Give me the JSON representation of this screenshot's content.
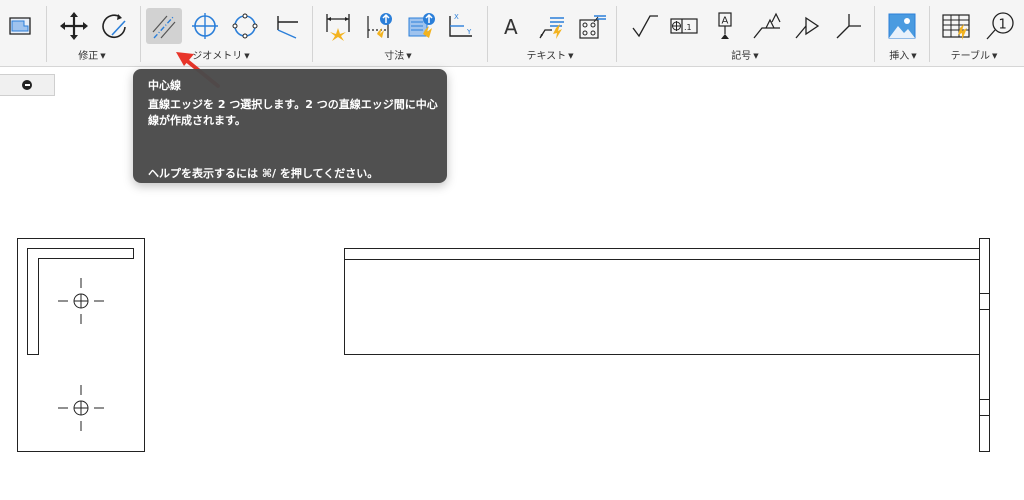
{
  "toolbar": {
    "groups": {
      "modify": "修正",
      "geometry": "ジオメトリ",
      "dimension": "寸法",
      "text": "テキスト",
      "symbol": "記号",
      "insert": "挿入",
      "table": "テーブル"
    },
    "caret": "▼",
    "icons": {
      "balloon_number": "1",
      "datum_axes": [
        "X",
        "Y"
      ],
      "feature_control": ".1",
      "text_tool": "A",
      "datum_tool": "A"
    }
  },
  "tooltip": {
    "title": "中心線",
    "description": "直線エッジを 2 つ選択します。2 つの直線エッジ間に中心線が作成されます。",
    "help": "ヘルプを表示するには ⌘/ を押してください。"
  },
  "colors": {
    "accent_blue": "#2b7fd9",
    "pointer_arrow": "#e8352a",
    "tooltip_bg": "#4a4a4a"
  }
}
